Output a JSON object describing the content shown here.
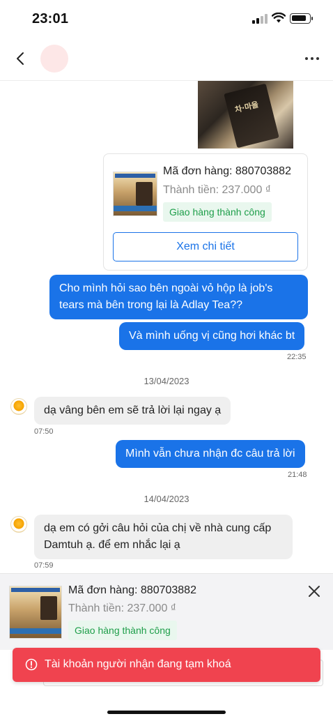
{
  "status_bar": {
    "time": "23:01"
  },
  "header": {
    "back_icon": "chevron-left-icon",
    "more_icon": "more-horizontal-icon"
  },
  "order_card": {
    "order_id": "Mã đơn hàng: 880703882",
    "total": "Thành tiền: 237.000 ₫",
    "status": "Giao hàng thành công",
    "detail_button": "Xem chi tiết"
  },
  "messages": [
    {
      "direction": "out",
      "text": "Cho mình hỏi sao bên ngoài vỏ hộp là job's tears mà bên trong lại là Adlay Tea??"
    },
    {
      "direction": "out",
      "text": "Và mình uống vị cũng hơi khác bt",
      "time": "22:35"
    },
    {
      "date": "13/04/2023"
    },
    {
      "direction": "in",
      "text": "dạ vâng bên em sẽ trả lời lại ngay ạ",
      "time": "07:50"
    },
    {
      "direction": "out",
      "text": "Mình vẫn chưa nhận đc câu trả lời",
      "time": "21:48"
    },
    {
      "date": "14/04/2023"
    },
    {
      "direction": "in",
      "text": "dạ em có gởi câu hỏi của chị về nhà cung cấp Damtuh ạ. để em nhắc lại ạ",
      "time": "07:59"
    }
  ],
  "pinned_order": {
    "order_id": "Mã đơn hàng: 880703882",
    "total": "Thành tiền: 237.000 ₫",
    "status": "Giao hàng thành công",
    "close_icon": "close-icon"
  },
  "toast": {
    "icon": "error-circle-icon",
    "text": "Tài khoản người nhận đang tạm khoá"
  },
  "colors": {
    "accent": "#1a73e8",
    "success": "#1e9e4a",
    "error": "#f0434f"
  }
}
